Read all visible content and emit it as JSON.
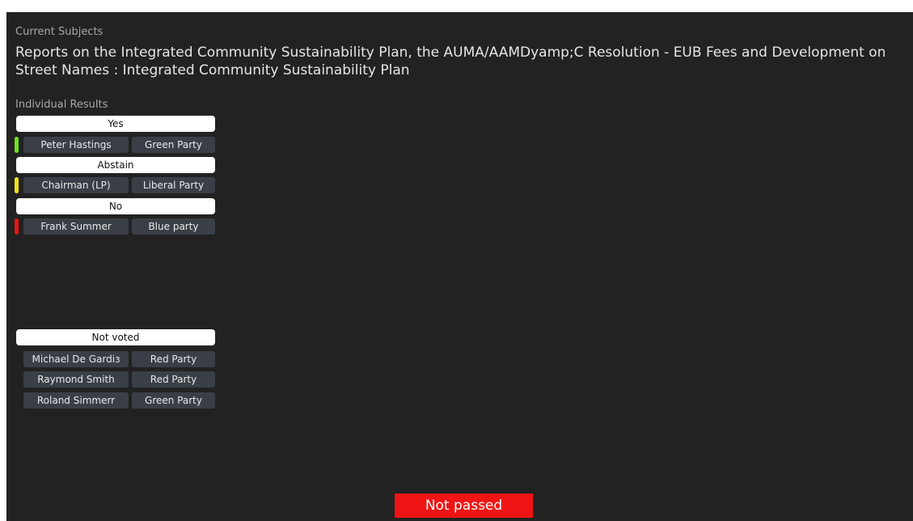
{
  "subject": {
    "label": "Current Subjects",
    "title": "Reports on the Integrated Community Sustainability Plan, the AUMA/AAMDyamp;C Resolution - EUB Fees and Development on Street Names : Integrated Community Sustainability Plan"
  },
  "results": {
    "label": "Individual Results",
    "groups": {
      "yes": {
        "label": "Yes",
        "color": "#6fe21f",
        "members": [
          {
            "name": "Peter Hastings",
            "party": "Green Party"
          }
        ]
      },
      "abstain": {
        "label": "Abstain",
        "color": "#f2e21a",
        "members": [
          {
            "name": "Chairman  (LP)",
            "party": "Liberal Party"
          }
        ]
      },
      "no": {
        "label": "No",
        "color": "#e81616",
        "members": [
          {
            "name": "Frank Summer",
            "party": "Blue party"
          }
        ]
      },
      "not_voted": {
        "label": "Not voted",
        "members": [
          {
            "name": "Michael De Gardiз",
            "party": "Red Party"
          },
          {
            "name": "Raymond Smith",
            "party": "Red Party"
          },
          {
            "name": "Roland  Simmerr",
            "party": "Green Party"
          }
        ]
      }
    }
  },
  "outcome": {
    "label": "Not passed",
    "color": "#f01414"
  }
}
